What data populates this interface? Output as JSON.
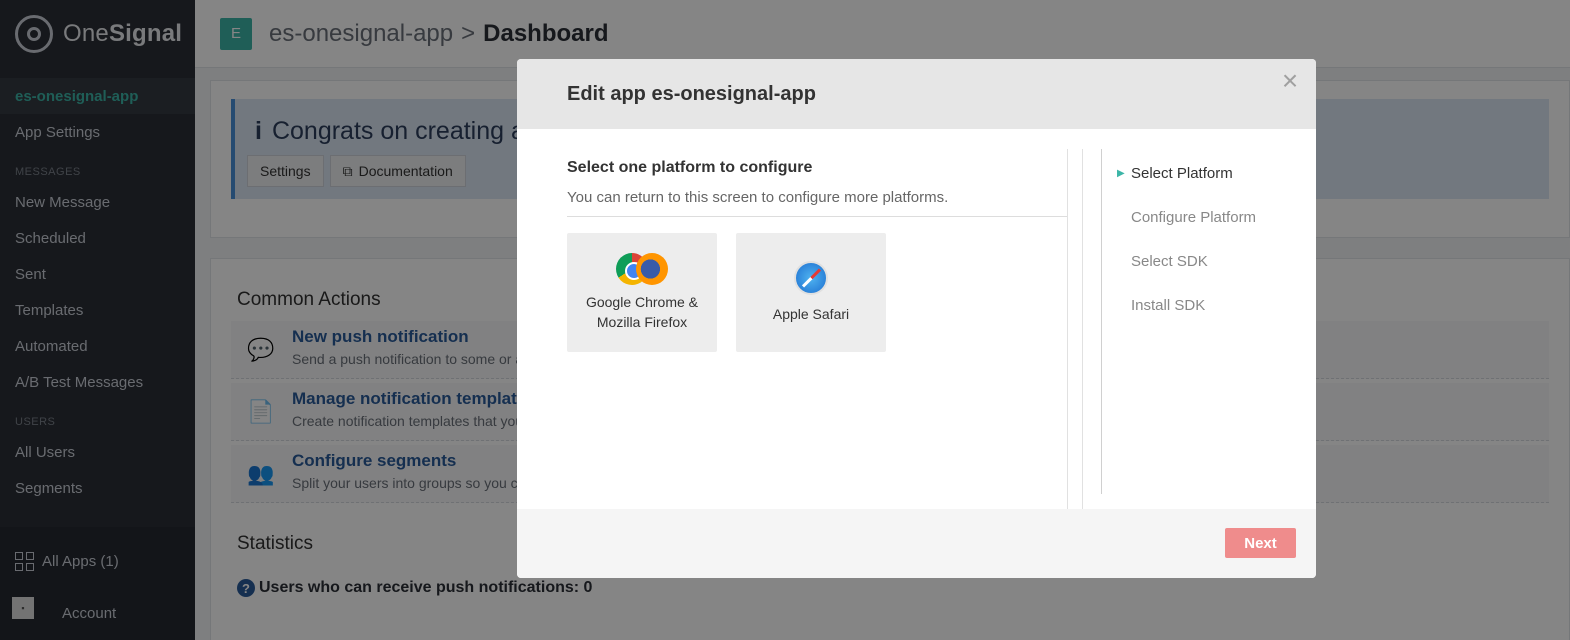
{
  "brand": {
    "name_light": "One",
    "name_bold": "Signal"
  },
  "sidebar": {
    "current_app": "es-onesignal-app",
    "app_settings": "App Settings",
    "messages_header": "MESSAGES",
    "message_items": [
      "New Message",
      "Scheduled",
      "Sent",
      "Templates",
      "Automated",
      "A/B Test Messages"
    ],
    "users_header": "USERS",
    "user_items": [
      "All Users",
      "Segments"
    ],
    "all_apps": "All Apps (1)",
    "account": "Account"
  },
  "topbar": {
    "app_initial": "E",
    "app_name": "es-onesignal-app",
    "separator": ">",
    "current_page": "Dashboard"
  },
  "banner": {
    "title": "Congrats on creating a ne",
    "settings_btn": "Settings",
    "docs_btn": "Documentation"
  },
  "common_actions": {
    "title": "Common Actions",
    "items": [
      {
        "title": "New push notification",
        "desc": "Send a push notification to some or a"
      },
      {
        "title": "Manage notification templates",
        "desc": "Create notification templates that you"
      },
      {
        "title": "Configure segments",
        "desc": "Split your users into groups so you ca"
      }
    ]
  },
  "statistics": {
    "title": "Statistics",
    "line": "Users who can receive push notifications: 0"
  },
  "modal": {
    "title": "Edit app es-onesignal-app",
    "close": "×",
    "content_title": "Select one platform to configure",
    "content_sub": "You can return to this screen to configure more platforms.",
    "platforms": [
      {
        "label_line1": "Google Chrome &",
        "label_line2": "Mozilla Firefox"
      },
      {
        "label_line1": "Apple Safari"
      }
    ],
    "steps": [
      "Select Platform",
      "Configure Platform",
      "Select SDK",
      "Install SDK"
    ],
    "next_button": "Next"
  },
  "colors": {
    "accent": "#3cb5a7",
    "link": "#2a5a99",
    "next_button": "#ef8c8c"
  }
}
